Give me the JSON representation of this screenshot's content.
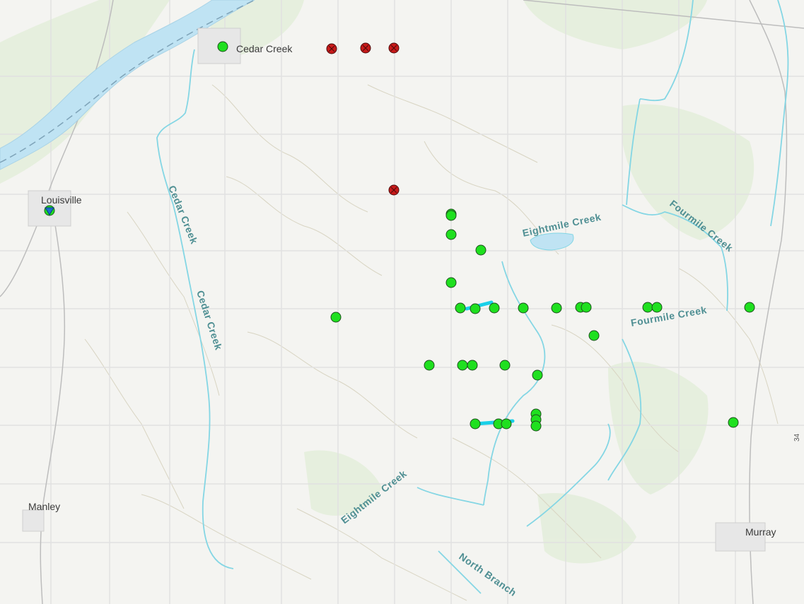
{
  "places": {
    "cedar_creek": "Cedar Creek",
    "louisville": "Louisville",
    "manley": "Manley",
    "murray": "Murray"
  },
  "waterways": {
    "cedar_creek_upper": "Cedar Creek",
    "cedar_creek_lower": "Cedar Creek",
    "eightmile_creek_north": "Eightmile Creek",
    "eightmile_creek_south": "Eightmile Creek",
    "fourmile_creek_north": "Fourmile Creek",
    "fourmile_creek_east": "Fourmile Creek",
    "north_branch": "North Branch"
  },
  "route": {
    "number": "34"
  },
  "colors": {
    "active_site": "#1fe01f",
    "inactive_site": "#c81a1a",
    "stream": "#84d6e4",
    "river": "#bfe3f3",
    "road": "#ffffff",
    "contour": "#d8d4c2"
  },
  "legend_semantics": {
    "green": "active-site-marker",
    "red": "inactive-site-marker",
    "cyan": "stream-gauge-segment"
  }
}
